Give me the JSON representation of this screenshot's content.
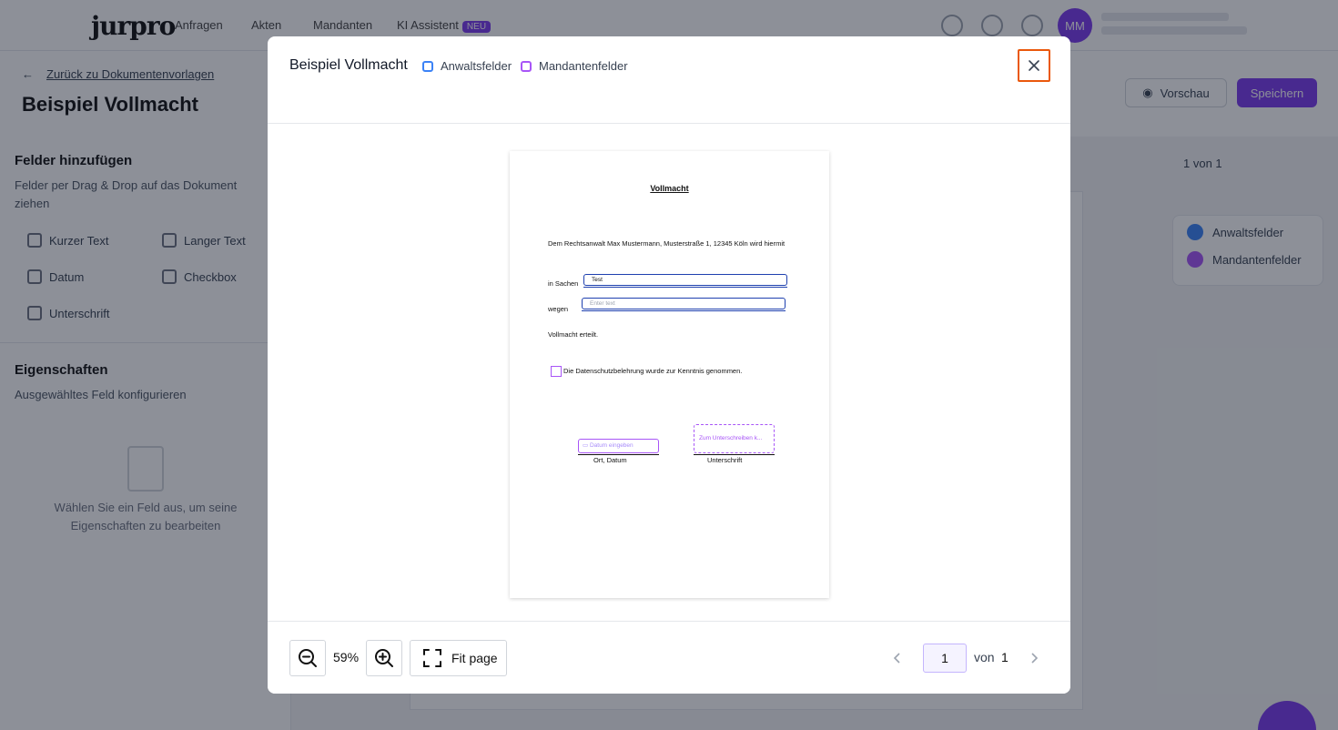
{
  "background_app": {
    "logo": "jurpro",
    "nav": [
      "Anfragen",
      "Akten",
      "Mandanten",
      "KI Assistent"
    ],
    "nav_badge": "NEU",
    "avatar_initials": "MM",
    "back_link": "Zurück zu Dokumentenvorlagen",
    "page_title": "Beispiel Vollmacht",
    "preview_button": "Vorschau",
    "save_button": "Speichern",
    "add_fields_heading": "Felder hinzufügen",
    "add_fields_hint": "Felder per Drag & Drop auf das Dokument ziehen",
    "tools": [
      "Kurzer Text",
      "Langer Text",
      "Datum",
      "Checkbox",
      "Unterschrift"
    ],
    "properties_heading": "Eigenschaften",
    "properties_hint": "Ausgewähltes Feld konfigurieren",
    "empty_state": "Wählen Sie ein Feld aus, um seine Eigenschaften zu bearbeiten",
    "legend": [
      "Anwaltsfelder",
      "Mandantenfelder"
    ],
    "page_nav": "1 von 1"
  },
  "modal": {
    "title": "Beispiel Vollmacht",
    "legend": [
      {
        "label": "Anwaltsfelder",
        "color": "#3b82f6"
      },
      {
        "label": "Mandantenfelder",
        "color": "#a855f7"
      }
    ],
    "close_icon": "close-icon"
  },
  "document": {
    "heading": "Vollmacht",
    "intro": "Dem Rechtsanwalt Max Mustermann, Musterstraße 1, 12345 Köln wird hiermit",
    "in_sachen_label": "in Sachen",
    "in_sachen_value": "Test",
    "wegen_label": "wegen",
    "wegen_placeholder": "Enter text",
    "granted": "Vollmacht erteilt.",
    "checkbox_text": "Die Datenschutzbelehrung wurde zur Kenntnis genommen.",
    "date_placeholder": "Datum eingeben",
    "date_caption": "Ort, Datum",
    "signature_placeholder": "Zum Unterschreiben k...",
    "signature_caption": "Unterschrift"
  },
  "footer": {
    "zoom": "59%",
    "fit_label": "Fit page",
    "current_page": "1",
    "of_label": "von",
    "total_pages": "1"
  },
  "colors": {
    "accent": "#7c3aed",
    "lawyer_field": "#1e40af",
    "client_field": "#a855f7",
    "close_focus": "#ea580c"
  }
}
